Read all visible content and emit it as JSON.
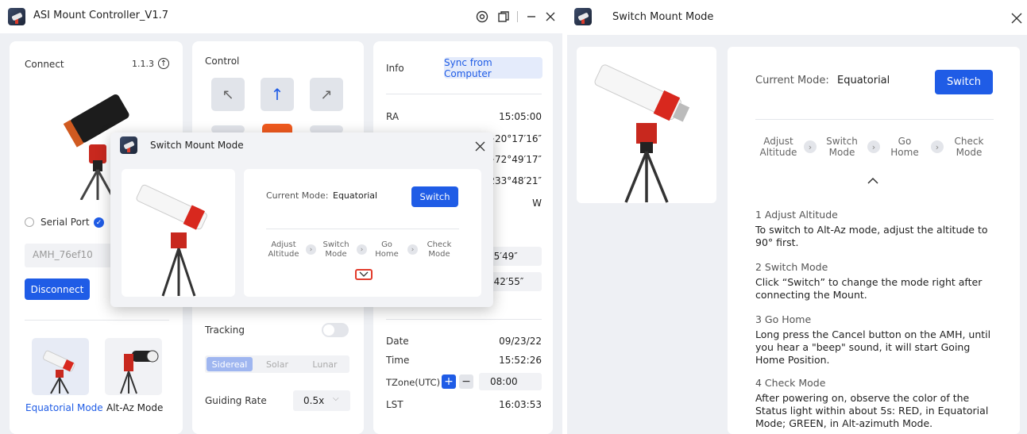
{
  "left": {
    "title": "ASI Mount Controller_V1.7",
    "connect": {
      "label": "Connect",
      "version": "1.1.3",
      "serial_label": "Serial Port",
      "device_id": "AMH_76ef10",
      "disconnect_label": "Disconnect",
      "modes": [
        "Equatorial Mode",
        "Alt-Az Mode"
      ]
    },
    "control": {
      "label": "Control",
      "tracking_label": "Tracking",
      "rates": [
        "Sidereal",
        "Solar",
        "Lunar"
      ],
      "guiding_label": "Guiding Rate",
      "guiding_value": "0.5x"
    },
    "info": {
      "label": "Info",
      "sync_label": "Sync from Computer",
      "ra_label": "RA",
      "ra_value": "15:05:00",
      "dec_value": "+20°17′16″",
      "alt_value": "+72°49′17″",
      "az_value": "233°48′21″",
      "pier_value": "W",
      "target1_value": "°15′49″",
      "target2_value": "0°42′55″",
      "date_label": "Date",
      "date_value": "09/23/22",
      "time_label": "Time",
      "time_value": "15:52:26",
      "tzone_label": "TZone(UTC)",
      "tzone_value": "08:00",
      "lst_label": "LST",
      "lst_value": "16:03:53"
    },
    "modal": {
      "title": "Switch Mount Mode",
      "current_mode_label": "Current Mode:",
      "current_mode_value": "Equatorial",
      "switch_label": "Switch",
      "steps": [
        [
          "Adjust",
          "Altitude"
        ],
        [
          "Switch",
          "Mode"
        ],
        [
          "Go",
          "Home"
        ],
        [
          "Check",
          "Mode"
        ]
      ]
    }
  },
  "right": {
    "title": "Switch Mount Mode",
    "current_mode_label": "Current Mode:",
    "current_mode_value": "Equatorial",
    "switch_label": "Switch",
    "steps": [
      [
        "Adjust",
        "Altitude"
      ],
      [
        "Switch",
        "Mode"
      ],
      [
        "Go",
        "Home"
      ],
      [
        "Check",
        "Mode"
      ]
    ],
    "instructions": [
      {
        "heading": "1 Adjust Altitude",
        "body": "To switch to Alt-Az mode, adjust the altitude to 90° first."
      },
      {
        "heading": "2 Switch Mode",
        "body": "Click “Switch” to change the mode right after connecting the Mount."
      },
      {
        "heading": "3 Go Home",
        "body": "Long press the Cancel button on the AMH, until you hear a \"beep\" sound, it will start Going Home Position."
      },
      {
        "heading": "4 Check Mode",
        "body": "After powering on, observe the color of the Status light within about 5s: RED, in Equatorial Mode; GREEN, in Alt-azimuth Mode."
      }
    ]
  },
  "colors": {
    "accent": "#1f5ce6",
    "highlight": "#e23b2b"
  }
}
